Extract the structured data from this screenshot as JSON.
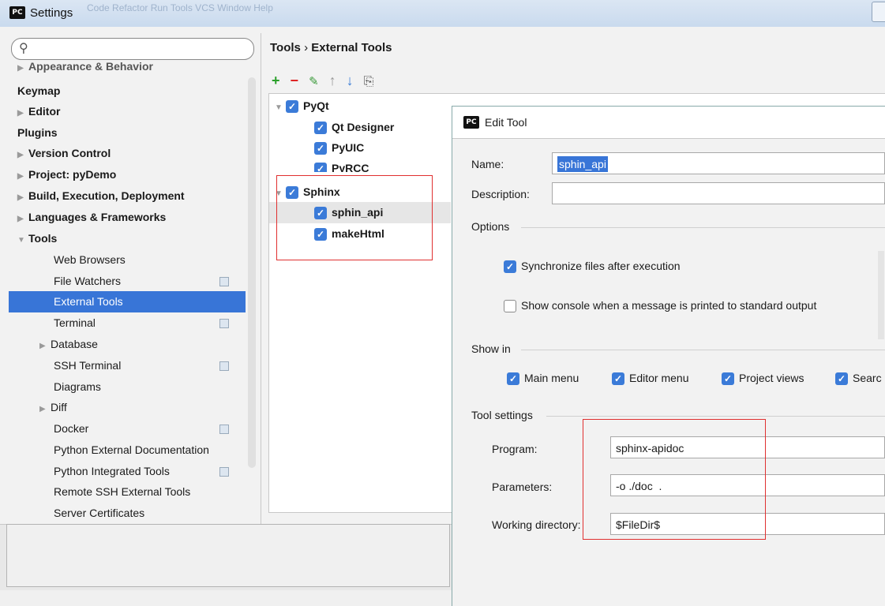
{
  "window": {
    "title": "Settings",
    "app_icon": "PC",
    "menu_blurred": "Code  Refactor  Run  Tools  VCS  Window  Help"
  },
  "left": {
    "search_placeholder": "",
    "cut_item": "Appearance & Behavior",
    "items": [
      {
        "label": "Keymap"
      },
      {
        "label": "Editor"
      },
      {
        "label": "Plugins"
      },
      {
        "label": "Version Control"
      },
      {
        "label": "Project: pyDemo"
      },
      {
        "label": "Build, Execution, Deployment"
      },
      {
        "label": "Languages & Frameworks"
      },
      {
        "label": "Tools"
      }
    ],
    "tools_children": [
      {
        "label": "Web Browsers"
      },
      {
        "label": "File Watchers"
      },
      {
        "label": "External Tools"
      },
      {
        "label": "Terminal"
      },
      {
        "label": "Database"
      },
      {
        "label": "SSH Terminal"
      },
      {
        "label": "Diagrams"
      },
      {
        "label": "Diff"
      },
      {
        "label": "Docker"
      },
      {
        "label": "Python External Documentation"
      },
      {
        "label": "Python Integrated Tools"
      },
      {
        "label": "Remote SSH External Tools"
      },
      {
        "label": "Server Certificates"
      }
    ]
  },
  "right": {
    "breadcrumb_root": "Tools",
    "breadcrumb_sep": "›",
    "breadcrumb_leaf": "External Tools",
    "toolbar": {
      "add": "+",
      "remove": "−",
      "edit": "✎",
      "up": "↑",
      "down": "↓",
      "copy": "⎘"
    },
    "groups": [
      {
        "name": "PyQt",
        "tools": [
          "Qt Designer",
          "PyUIC",
          "PyRCC"
        ]
      },
      {
        "name": "Sphinx",
        "tools": [
          "sphin_api",
          "makeHtml"
        ]
      }
    ]
  },
  "dialog": {
    "title": "Edit Tool",
    "icon": "PC",
    "name_label": "Name:",
    "name_value": "sphin_api",
    "description_label": "Description:",
    "description_value": "",
    "options_label": "Options",
    "sync_label": "Synchronize files after execution",
    "sync_checked": true,
    "console_label": "Show console when a message is printed to standard output",
    "console_checked": false,
    "show_in_label": "Show in",
    "show_in": [
      "Main menu",
      "Editor menu",
      "Project views",
      "Searc"
    ],
    "tool_settings_label": "Tool settings",
    "program_label": "Program:",
    "program_value": "sphinx-apidoc",
    "parameters_label": "Parameters:",
    "parameters_value": "-o ./doc  .",
    "workdir_label": "Working directory:",
    "workdir_value": "$FileDir$"
  },
  "colors": {
    "selection": "#3875d7",
    "checkbox": "#3b7bd8",
    "highlight_box": "#e03030"
  }
}
